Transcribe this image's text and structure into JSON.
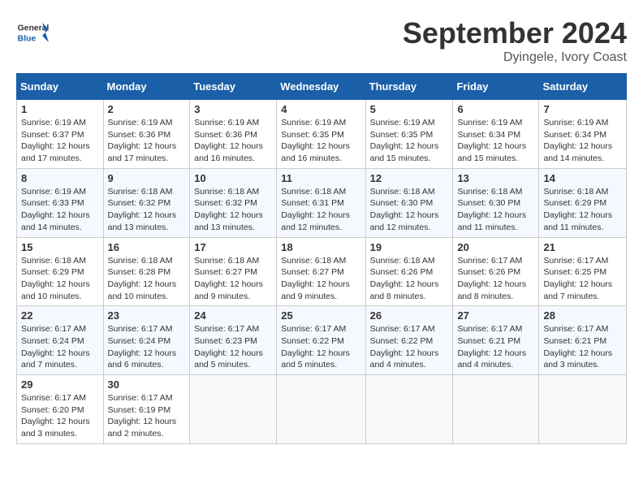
{
  "header": {
    "logo_general": "General",
    "logo_blue": "Blue",
    "month_year": "September 2024",
    "location": "Dyingele, Ivory Coast"
  },
  "weekdays": [
    "Sunday",
    "Monday",
    "Tuesday",
    "Wednesday",
    "Thursday",
    "Friday",
    "Saturday"
  ],
  "weeks": [
    [
      {
        "day": "1",
        "sunrise": "6:19 AM",
        "sunset": "6:37 PM",
        "daylight": "12 hours and 17 minutes."
      },
      {
        "day": "2",
        "sunrise": "6:19 AM",
        "sunset": "6:36 PM",
        "daylight": "12 hours and 17 minutes."
      },
      {
        "day": "3",
        "sunrise": "6:19 AM",
        "sunset": "6:36 PM",
        "daylight": "12 hours and 16 minutes."
      },
      {
        "day": "4",
        "sunrise": "6:19 AM",
        "sunset": "6:35 PM",
        "daylight": "12 hours and 16 minutes."
      },
      {
        "day": "5",
        "sunrise": "6:19 AM",
        "sunset": "6:35 PM",
        "daylight": "12 hours and 15 minutes."
      },
      {
        "day": "6",
        "sunrise": "6:19 AM",
        "sunset": "6:34 PM",
        "daylight": "12 hours and 15 minutes."
      },
      {
        "day": "7",
        "sunrise": "6:19 AM",
        "sunset": "6:34 PM",
        "daylight": "12 hours and 14 minutes."
      }
    ],
    [
      {
        "day": "8",
        "sunrise": "6:19 AM",
        "sunset": "6:33 PM",
        "daylight": "12 hours and 14 minutes."
      },
      {
        "day": "9",
        "sunrise": "6:18 AM",
        "sunset": "6:32 PM",
        "daylight": "12 hours and 13 minutes."
      },
      {
        "day": "10",
        "sunrise": "6:18 AM",
        "sunset": "6:32 PM",
        "daylight": "12 hours and 13 minutes."
      },
      {
        "day": "11",
        "sunrise": "6:18 AM",
        "sunset": "6:31 PM",
        "daylight": "12 hours and 12 minutes."
      },
      {
        "day": "12",
        "sunrise": "6:18 AM",
        "sunset": "6:30 PM",
        "daylight": "12 hours and 12 minutes."
      },
      {
        "day": "13",
        "sunrise": "6:18 AM",
        "sunset": "6:30 PM",
        "daylight": "12 hours and 11 minutes."
      },
      {
        "day": "14",
        "sunrise": "6:18 AM",
        "sunset": "6:29 PM",
        "daylight": "12 hours and 11 minutes."
      }
    ],
    [
      {
        "day": "15",
        "sunrise": "6:18 AM",
        "sunset": "6:29 PM",
        "daylight": "12 hours and 10 minutes."
      },
      {
        "day": "16",
        "sunrise": "6:18 AM",
        "sunset": "6:28 PM",
        "daylight": "12 hours and 10 minutes."
      },
      {
        "day": "17",
        "sunrise": "6:18 AM",
        "sunset": "6:27 PM",
        "daylight": "12 hours and 9 minutes."
      },
      {
        "day": "18",
        "sunrise": "6:18 AM",
        "sunset": "6:27 PM",
        "daylight": "12 hours and 9 minutes."
      },
      {
        "day": "19",
        "sunrise": "6:18 AM",
        "sunset": "6:26 PM",
        "daylight": "12 hours and 8 minutes."
      },
      {
        "day": "20",
        "sunrise": "6:17 AM",
        "sunset": "6:26 PM",
        "daylight": "12 hours and 8 minutes."
      },
      {
        "day": "21",
        "sunrise": "6:17 AM",
        "sunset": "6:25 PM",
        "daylight": "12 hours and 7 minutes."
      }
    ],
    [
      {
        "day": "22",
        "sunrise": "6:17 AM",
        "sunset": "6:24 PM",
        "daylight": "12 hours and 7 minutes."
      },
      {
        "day": "23",
        "sunrise": "6:17 AM",
        "sunset": "6:24 PM",
        "daylight": "12 hours and 6 minutes."
      },
      {
        "day": "24",
        "sunrise": "6:17 AM",
        "sunset": "6:23 PM",
        "daylight": "12 hours and 5 minutes."
      },
      {
        "day": "25",
        "sunrise": "6:17 AM",
        "sunset": "6:22 PM",
        "daylight": "12 hours and 5 minutes."
      },
      {
        "day": "26",
        "sunrise": "6:17 AM",
        "sunset": "6:22 PM",
        "daylight": "12 hours and 4 minutes."
      },
      {
        "day": "27",
        "sunrise": "6:17 AM",
        "sunset": "6:21 PM",
        "daylight": "12 hours and 4 minutes."
      },
      {
        "day": "28",
        "sunrise": "6:17 AM",
        "sunset": "6:21 PM",
        "daylight": "12 hours and 3 minutes."
      }
    ],
    [
      {
        "day": "29",
        "sunrise": "6:17 AM",
        "sunset": "6:20 PM",
        "daylight": "12 hours and 3 minutes."
      },
      {
        "day": "30",
        "sunrise": "6:17 AM",
        "sunset": "6:19 PM",
        "daylight": "12 hours and 2 minutes."
      },
      null,
      null,
      null,
      null,
      null
    ]
  ]
}
